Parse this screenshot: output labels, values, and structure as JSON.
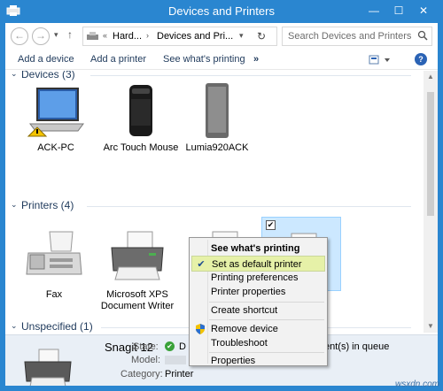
{
  "window": {
    "title": "Devices and Printers",
    "controls": {
      "minimize": "—",
      "maximize": "☐",
      "close": "✕"
    }
  },
  "nav": {
    "back": "←",
    "forward": "→",
    "recent": "▾",
    "up": "↑",
    "breadcrumb": [
      "Hard...",
      "Devices and Pri..."
    ],
    "crumb_prefix": "«",
    "crumb_sep": "›",
    "address_dropdown": "▾",
    "refresh": "↻"
  },
  "search": {
    "placeholder": "Search Devices and Printers"
  },
  "commands": {
    "add_device": "Add a device",
    "add_printer": "Add a printer",
    "see_whats_printing": "See what's printing",
    "more": "»",
    "help": "?"
  },
  "groups": {
    "devices": "Devices (3)",
    "printers": "Printers (4)",
    "unspecified": "Unspecified (1)"
  },
  "devices": [
    {
      "name": "ACK-PC",
      "icon": "laptop-warning-icon"
    },
    {
      "name": "Arc Touch Mouse",
      "icon": "mouse-icon"
    },
    {
      "name": "Lumia920ACK",
      "icon": "phone-icon"
    }
  ],
  "printers": [
    {
      "name": "Fax",
      "icon": "fax-icon"
    },
    {
      "name": "Microsoft XPS Document Writer",
      "icon": "printer-icon"
    },
    {
      "name": "",
      "icon": "printer-icon"
    },
    {
      "name": "",
      "icon": "printer-icon",
      "selected": true
    }
  ],
  "details": {
    "name": "Snagit 12",
    "state_label": "State:",
    "state_value": "D",
    "docs_text": "ent(s) in queue",
    "model_label": "Model:",
    "category_label": "Category:",
    "category_value": "Printer"
  },
  "context_menu": [
    {
      "label": "See what's printing",
      "bold": true
    },
    {
      "label": "Set as default printer",
      "highlighted": true,
      "check": "✔"
    },
    {
      "label": "Printing preferences"
    },
    {
      "label": "Printer properties"
    },
    {
      "label": "Create shortcut"
    },
    {
      "label": "Remove device",
      "icon": "uac-shield-icon"
    },
    {
      "label": "Troubleshoot"
    },
    {
      "label": "Properties"
    }
  ],
  "watermark": "wsxdn.com",
  "colors": {
    "accent": "#2a86d0",
    "link": "#1e395b",
    "selection": "#cce8ff",
    "menu_highlight": "#e6f1a8"
  }
}
